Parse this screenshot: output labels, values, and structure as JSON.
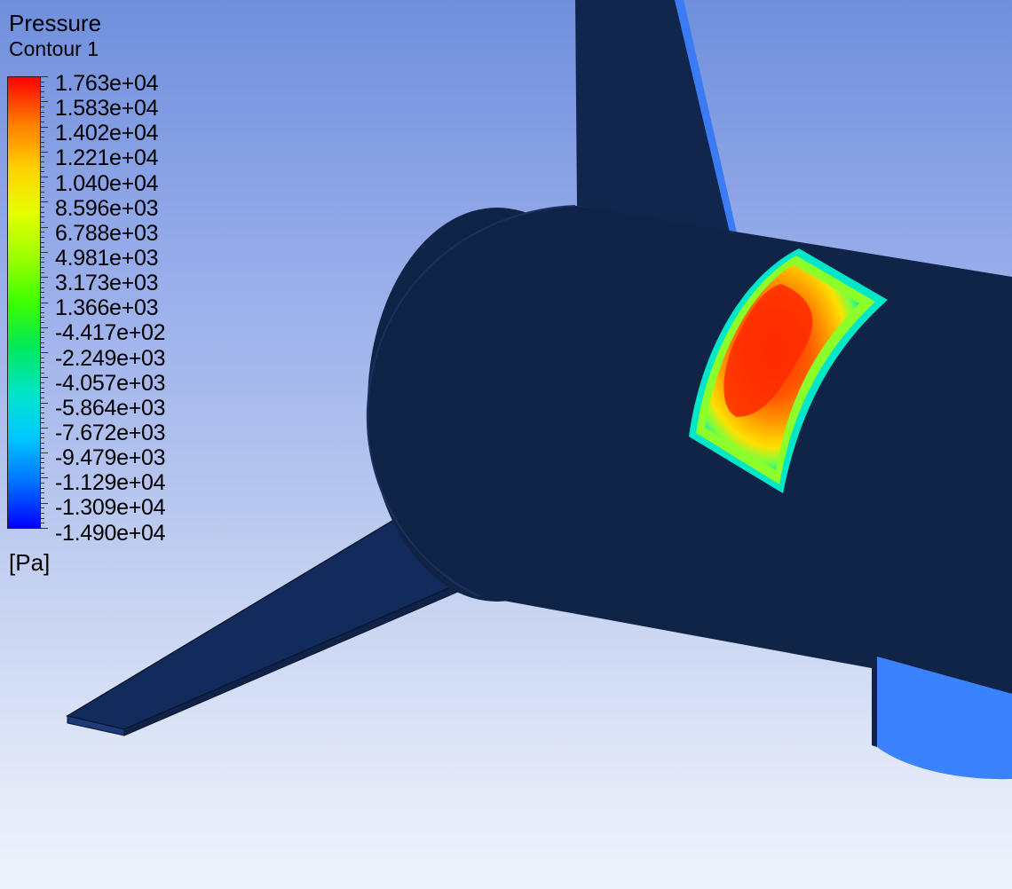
{
  "legend": {
    "title": "Pressure",
    "subtitle": "Contour 1",
    "units": "[Pa]",
    "values": [
      "1.763e+04",
      "1.583e+04",
      "1.402e+04",
      "1.221e+04",
      "1.040e+04",
      "8.596e+03",
      "6.788e+03",
      "4.981e+03",
      "3.173e+03",
      "1.366e+03",
      "-4.417e+02",
      "-2.249e+03",
      "-4.057e+03",
      "-5.864e+03",
      "-7.672e+03",
      "-9.479e+03",
      "-1.129e+04",
      "-1.309e+04",
      "-1.490e+04"
    ],
    "colormap": [
      "#ff0000",
      "#ff7a00",
      "#ffd000",
      "#e6ff00",
      "#9cff00",
      "#3dff00",
      "#00e85a",
      "#00e6c8",
      "#00c8ff",
      "#0070ff",
      "#0000ff"
    ]
  },
  "scene": {
    "body_color": "#0f2447",
    "surface_highlight": "#3b82ff",
    "contour_peak": "#ff2a00"
  }
}
